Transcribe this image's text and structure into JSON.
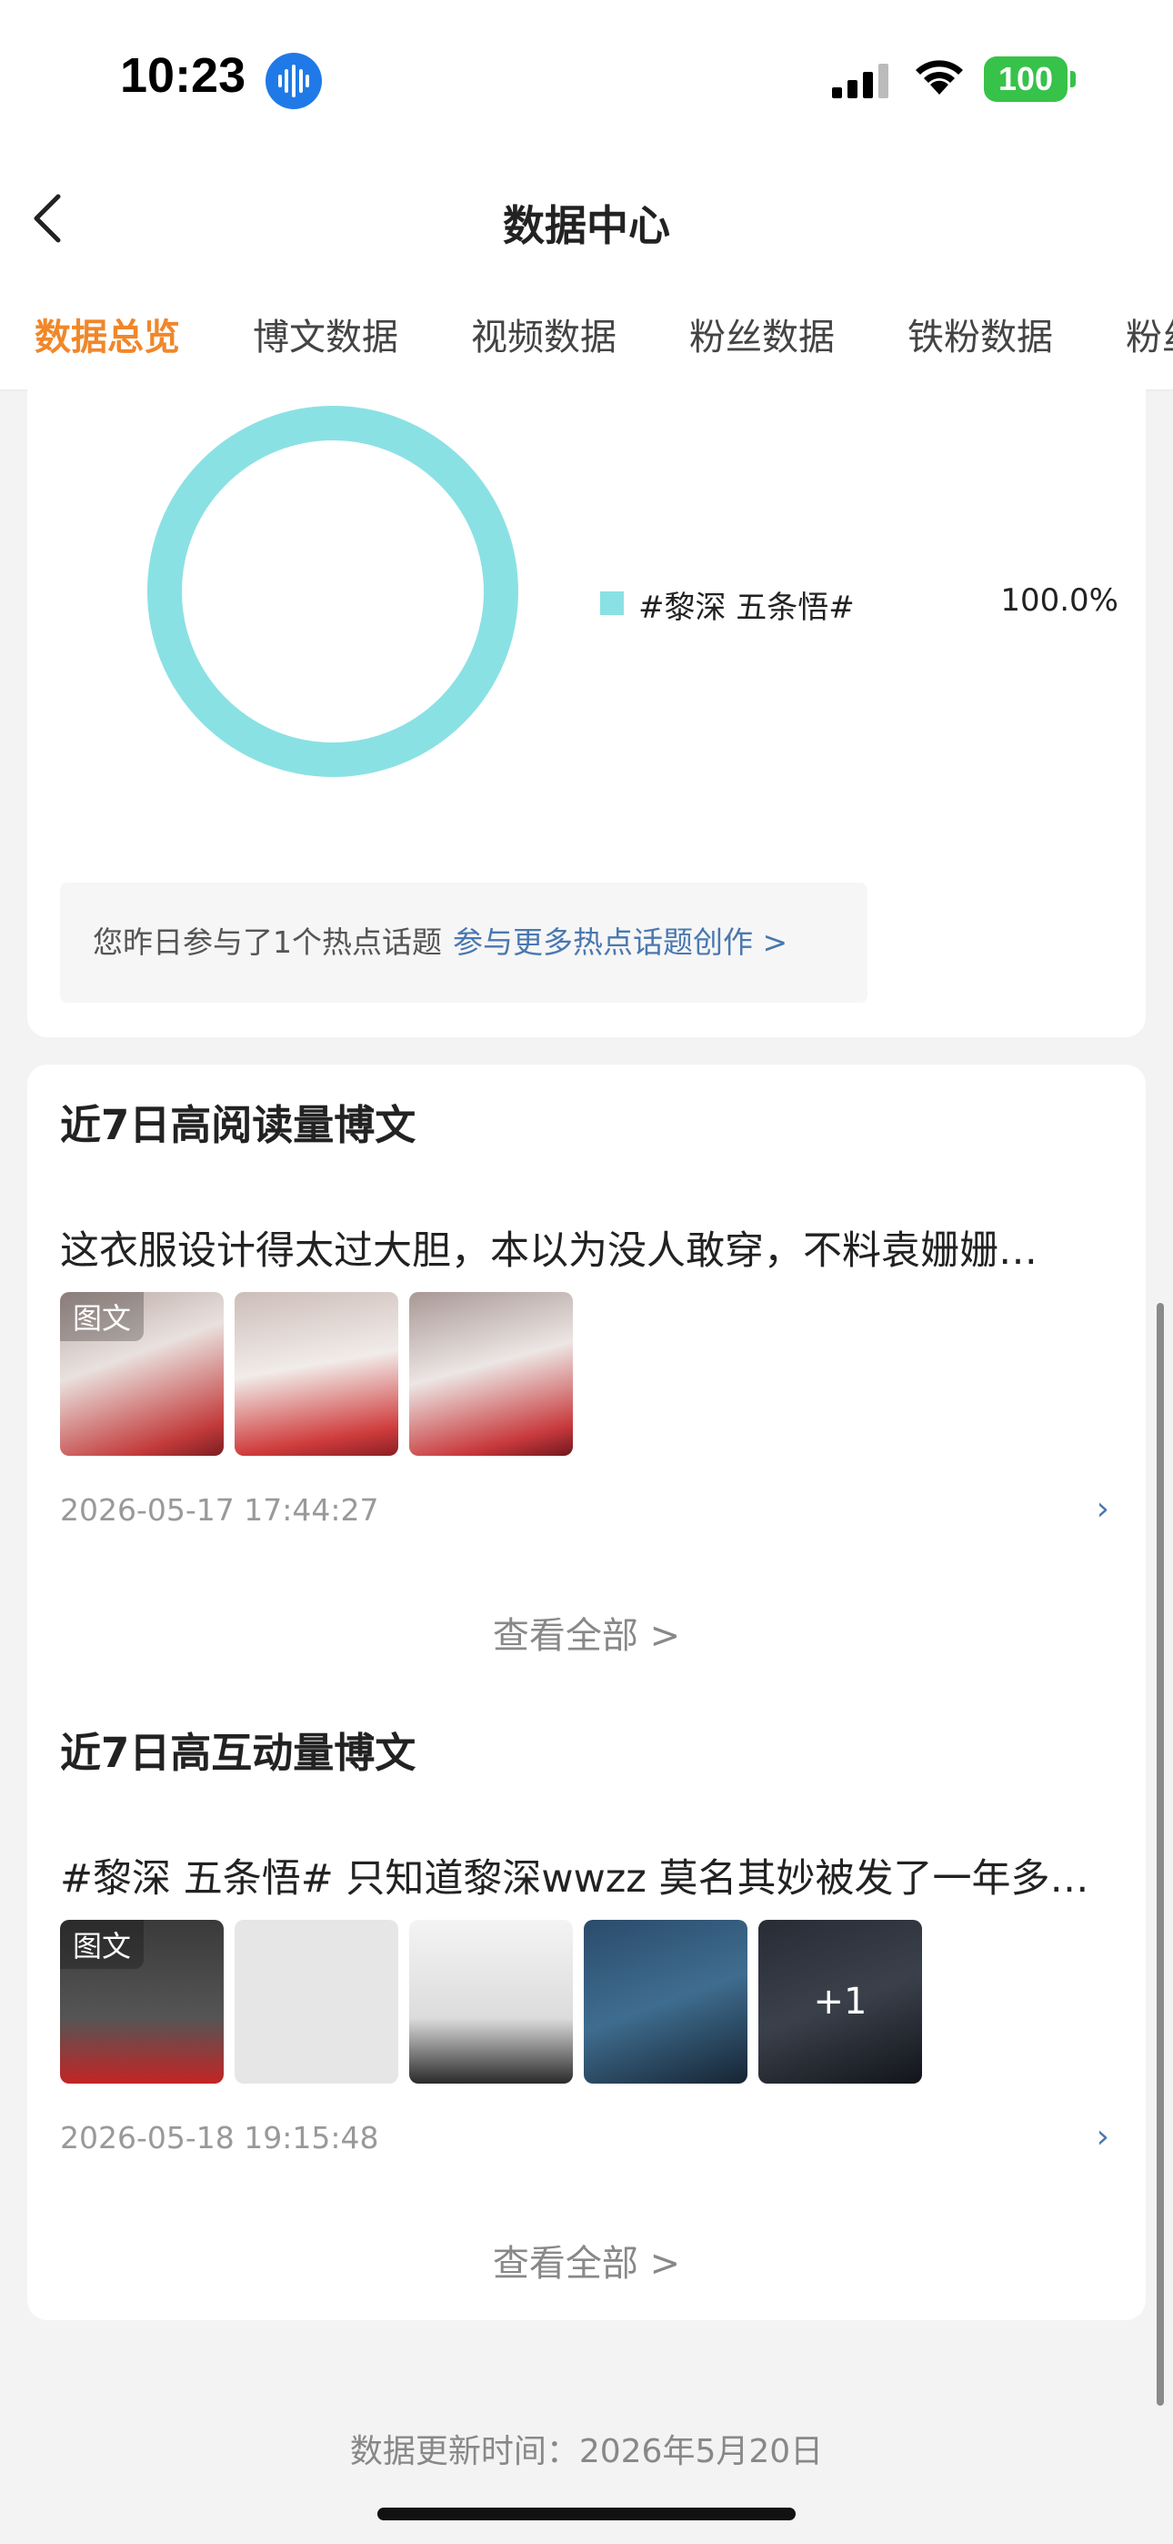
{
  "status_bar": {
    "time": "10:23",
    "battery": "100"
  },
  "header": {
    "title": "数据中心"
  },
  "tabs": [
    {
      "label": "数据总览",
      "active": true
    },
    {
      "label": "博文数据",
      "active": false
    },
    {
      "label": "视频数据",
      "active": false
    },
    {
      "label": "粉丝数据",
      "active": false
    },
    {
      "label": "铁粉数据",
      "active": false
    },
    {
      "label": "粉丝",
      "active": false
    }
  ],
  "topic_chart": {
    "chart_data": {
      "type": "pie",
      "categories": [
        "#黎深 五条悟#"
      ],
      "values": [
        100.0
      ],
      "value_labels": [
        "100.0%"
      ]
    },
    "legend": [
      {
        "label": "#黎深 五条悟#",
        "value": "100.0%",
        "color": "#8ae1e4"
      }
    ],
    "hint": {
      "text": "您昨日参与了1个热点话题",
      "link": "参与更多热点话题创作 >"
    }
  },
  "top_read": {
    "title": "近7日高阅读量博文",
    "post_text": "这衣服设计得太过大胆，本以为没人敢穿，不料袁姗姗…",
    "thumb_tag": "图文",
    "date": "2026-05-17 17:44:27",
    "view_all": "查看全部 >"
  },
  "top_interact": {
    "title": "近7日高互动量博文",
    "post_text": "#黎深 五条悟# 只知道黎深wwzz 莫名其妙被发了一年多…",
    "thumb_tag": "图文",
    "more_count": "+1",
    "date": "2026-05-18 19:15:48",
    "view_all": "查看全部 >"
  },
  "footer": {
    "update_time": "数据更新时间：2026年5月20日"
  }
}
